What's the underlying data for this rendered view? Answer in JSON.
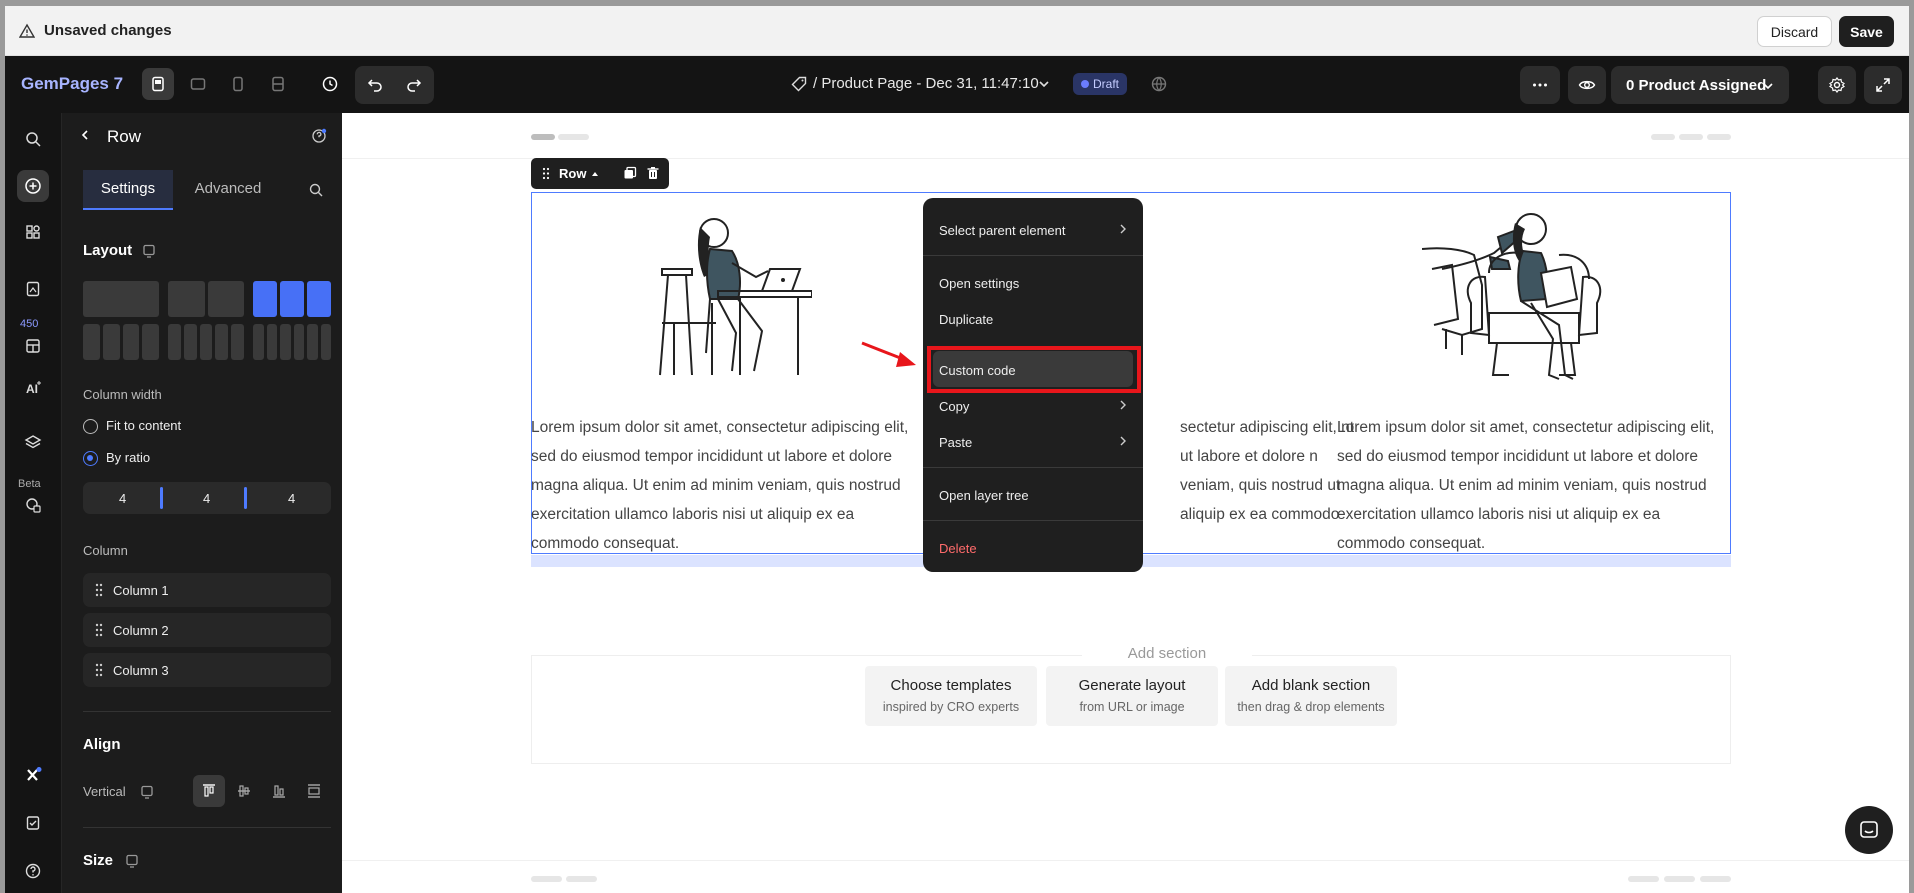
{
  "unsaved_bar": {
    "message": "Unsaved changes",
    "discard_label": "Discard",
    "save_label": "Save"
  },
  "toolbar": {
    "logo": "GemPages 7",
    "page_title": "/ Product Page - Dec 31, 11:47:10",
    "status_badge": "Draft",
    "product_assigned": "0 Product Assigned",
    "icons": [
      "desktop-icon",
      "tablet-landscape-icon",
      "mobile-icon",
      "responsive-icon",
      "history-icon",
      "undo-icon",
      "redo-icon",
      "tag-icon",
      "chevron-down-icon",
      "translate-icon",
      "more-icon",
      "eye-icon",
      "gear-icon",
      "expand-icon"
    ]
  },
  "rail": {
    "badge": "450",
    "beta": "Beta",
    "icons": [
      "search-icon",
      "add-icon",
      "elements-icon",
      "pages-icon",
      "templates-icon",
      "ai-icon",
      "layers-icon",
      "code-icon",
      "x-icon",
      "checklist-icon",
      "help-icon"
    ]
  },
  "panel": {
    "title": "Row",
    "tabs": [
      "Settings",
      "Advanced"
    ],
    "layout_label": "Layout",
    "column_width_label": "Column width",
    "fit_label": "Fit to content",
    "ratio_label": "By ratio",
    "ratios": [
      "4",
      "4",
      "4"
    ],
    "column_label": "Column",
    "columns": [
      "Column 1",
      "Column 2",
      "Column 3"
    ],
    "align_label": "Align",
    "vertical_label": "Vertical",
    "size_label": "Size"
  },
  "canvas": {
    "row_tag": "Row",
    "lorem": "Lorem ipsum dolor sit amet, consectetur adipiscing elit, sed do eiusmod tempor incididunt ut labore et dolore magna aliqua. Ut enim ad minim veniam, quis nostrud exercitation ullamco laboris nisi ut aliquip ex ea commodo consequat.",
    "lorem_middle": "sectetur adipiscing elit, nt ut labore et dolore n veniam, quis nostrud ut aliquip ex ea commodo",
    "add_section": "Add section",
    "cards": [
      {
        "title": "Choose templates",
        "subtitle": "inspired by CRO experts"
      },
      {
        "title": "Generate layout",
        "subtitle": "from URL or image"
      },
      {
        "title": "Add blank section",
        "subtitle": "then drag & drop elements"
      }
    ]
  },
  "context_menu": {
    "items": [
      {
        "label": "Select parent element",
        "submenu": true
      },
      {
        "label": "Open settings",
        "submenu": false
      },
      {
        "label": "Duplicate",
        "submenu": false
      },
      {
        "label": "Custom code",
        "submenu": false
      },
      {
        "label": "Copy",
        "submenu": true
      },
      {
        "label": "Paste",
        "submenu": true
      },
      {
        "label": "Open layer tree",
        "submenu": false
      },
      {
        "label": "Delete",
        "submenu": false
      }
    ]
  },
  "colors": {
    "accent": "#4e7bff",
    "highlight": "#e8161b",
    "danger": "#ff6b6b"
  }
}
